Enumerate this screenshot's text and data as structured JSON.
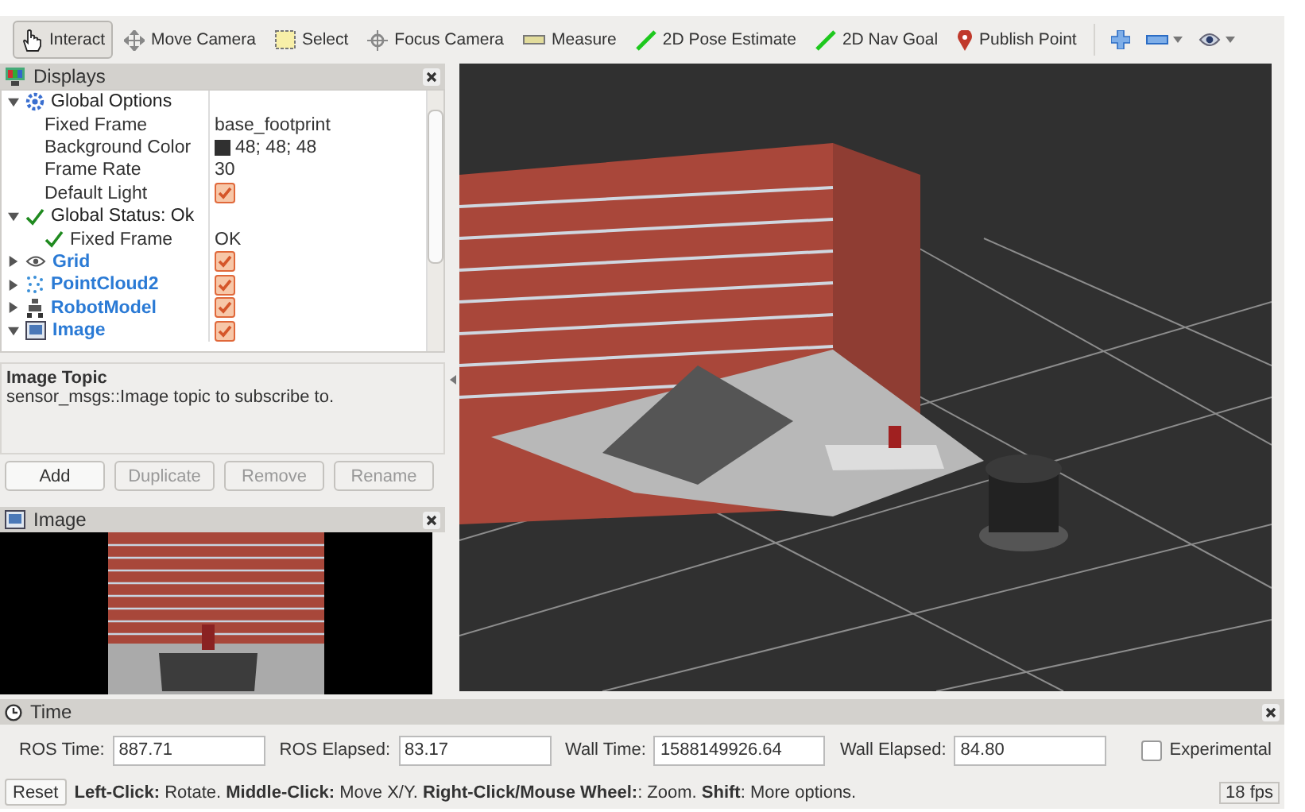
{
  "toolbar": {
    "tools": [
      {
        "label": "Interact",
        "selected": true
      },
      {
        "label": "Move Camera",
        "selected": false
      },
      {
        "label": "Select",
        "selected": false
      },
      {
        "label": "Focus Camera",
        "selected": false
      },
      {
        "label": "Measure",
        "selected": false
      },
      {
        "label": "2D Pose Estimate",
        "selected": false
      },
      {
        "label": "2D Nav Goal",
        "selected": false
      },
      {
        "label": "Publish Point",
        "selected": false
      }
    ],
    "actions": [
      {
        "menu": false
      },
      {
        "menu": true
      },
      {
        "menu": true
      }
    ]
  },
  "displays": {
    "title": "Displays",
    "items": [
      {
        "kind": "group",
        "label": "Global Options",
        "expanded": true,
        "children": [
          {
            "kind": "property",
            "label": "Fixed Frame",
            "value": "base_footprint"
          },
          {
            "kind": "color",
            "label": "Background Color",
            "value": "48; 48; 48",
            "color": "#303030"
          },
          {
            "kind": "property",
            "label": "Frame Rate",
            "value": "30"
          },
          {
            "kind": "checkbox",
            "label": "Default Light",
            "checked": true
          }
        ]
      },
      {
        "kind": "status",
        "label": "Global Status: Ok",
        "expanded": true,
        "children": [
          {
            "kind": "status",
            "label": "Fixed Frame",
            "value": "OK"
          }
        ]
      },
      {
        "kind": "display",
        "label": "Grid",
        "expanded": false,
        "checked": true
      },
      {
        "kind": "display",
        "label": "PointCloud2",
        "expanded": false,
        "checked": true
      },
      {
        "kind": "display",
        "label": "RobotModel",
        "expanded": false,
        "checked": true
      },
      {
        "kind": "display",
        "label": "Image",
        "expanded": true,
        "checked": true
      }
    ],
    "description": {
      "title": "Image Topic",
      "text": "sensor_msgs::Image topic to subscribe to."
    },
    "buttons": [
      {
        "label": "Add",
        "disabled": false
      },
      {
        "label": "Duplicate",
        "disabled": true
      },
      {
        "label": "Remove",
        "disabled": true
      },
      {
        "label": "Rename",
        "disabled": true
      }
    ]
  },
  "image_panel": {
    "title": "Image"
  },
  "time_panel": {
    "title": "Time",
    "fields": [
      {
        "label": "ROS Time:",
        "value": "887.71"
      },
      {
        "label": "ROS Elapsed:",
        "value": "83.17"
      },
      {
        "label": "Wall Time:",
        "value": "1588149926.64"
      },
      {
        "label": "Wall Elapsed:",
        "value": "84.80"
      }
    ],
    "experimental": {
      "label": "Experimental",
      "checked": false
    }
  },
  "status_bar": {
    "button": "Reset",
    "help": "**Left-Click:** Rotate. **Middle-Click:** Move X/Y. **Right-Click/Mouse Wheel:**: Zoom. **Shift**: More options.",
    "fps": "18 fps"
  }
}
